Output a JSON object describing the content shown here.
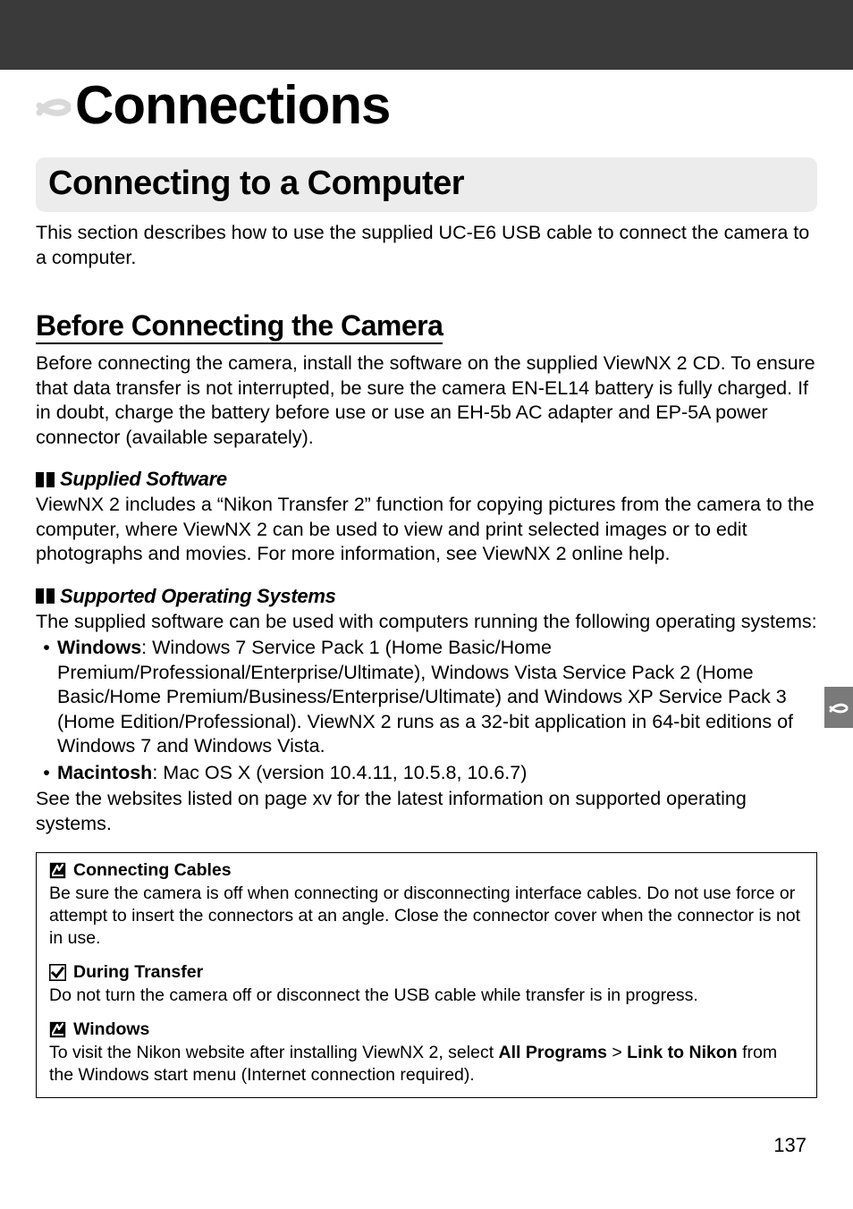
{
  "chapter_title": "Connections",
  "section_title": "Connecting to a Computer",
  "intro_text": "This section describes how to use the supplied UC-E6 USB cable to connect the camera to a computer.",
  "subsection_title": "Before Connecting the Camera",
  "subsection_text": "Before connecting the camera, install the software on the supplied ViewNX 2 CD.  To ensure that data transfer is not interrupted, be sure the camera EN-EL14 battery is fully charged.  If in doubt, charge the battery before use or use an EH-5b AC adapter and EP-5A power connector (available separately).",
  "supplied_head": "Supplied Software",
  "supplied_text": "ViewNX 2 includes a “Nikon Transfer 2” function for copying pictures from the camera to the computer, where ViewNX 2 can be used to view and print selected images or to edit photographs and movies.  For more information, see ViewNX 2 online help.",
  "os_head": "Supported Operating Systems",
  "os_text": "The supplied software can be used with computers running the following operating systems:",
  "win_label": "Windows",
  "win_text": ": Windows 7 Service Pack 1 (Home Basic/Home Premium/Professional/Enterprise/Ultimate), Windows Vista Service Pack 2 (Home Basic/Home Premium/Business/Enterprise/Ultimate) and Windows XP Service Pack 3 (Home Edition/Professional).  ViewNX 2 runs as a 32-bit application in 64-bit editions of Windows 7 and Windows Vista.",
  "mac_label": "Macintosh",
  "mac_text": ": Mac OS X (version 10.4.11, 10.5.8, 10.6.7)",
  "os_footer": "See the websites listed on page xv for the latest information on supported operating systems.",
  "note1_title": "Connecting Cables",
  "note1_body": "Be sure the camera is off when connecting or disconnecting interface cables.  Do not use force or attempt to insert the connectors at an angle.  Close the connector cover when the connector is not in use.",
  "note2_title": "During Transfer",
  "note2_body": "Do not turn the camera off or disconnect the USB cable while transfer is in progress.",
  "note3_title": "Windows",
  "note3_body_a": "To visit the Nikon website after installing ViewNX 2, select ",
  "note3_b1": "All Programs",
  "note3_sep": " > ",
  "note3_b2": "Link to Nikon",
  "note3_body_b": " from the Windows start menu (Internet connection required).",
  "page_number": "137"
}
